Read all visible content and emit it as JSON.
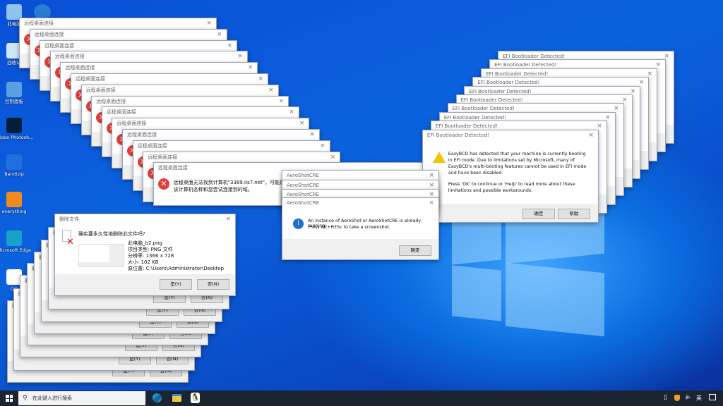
{
  "desktop": {
    "icons": [
      {
        "label": "此电脑",
        "icon": "computer-icon",
        "color": "#8ec5f0"
      },
      {
        "label": "回收站",
        "icon": "recycle-bin-icon",
        "color": "#cfe6f7"
      },
      {
        "label": "控制面板",
        "icon": "control-panel-icon",
        "color": "#5aa0e0"
      },
      {
        "label": "Adobe Photosh...",
        "icon": "photoshop-icon",
        "color": "#001e36"
      },
      {
        "label": "Bandizip",
        "icon": "bandizip-icon",
        "color": "#1f6fe0"
      },
      {
        "label": "everything",
        "icon": "everything-icon",
        "color": "#f08a1c"
      },
      {
        "label": "Microsoft Edge",
        "icon": "edge-icon",
        "color": "#1aa1c8"
      },
      {
        "label": "QQ",
        "icon": "qq-icon",
        "color": "#ffffff"
      }
    ]
  },
  "remote": {
    "title": "远程桌面连接",
    "message_line1": "远程桌面无法找到计算机\"3389.iis7.net\"。可能是\"338",
    "message_line2": "该计算机名称和您尝试连接到的域。"
  },
  "efi": {
    "title": "EFI Bootloader Detected!",
    "close": "×",
    "message1": "EasyBCD has detected that your machine is currently booting in EFI mode. Due to limitations set by Microsoft, many of EasyBCD's multi-booting features cannot be used in EFI mode and have been disabled.",
    "message2": "Press 'OK' to continue or 'Help' to read more about these limitations and possible workarounds.",
    "ok": "确定",
    "help": "帮助"
  },
  "aero": {
    "title": "AeroShotCRE",
    "message1": "An instance of AeroShot or AeroShotCRE is already running.",
    "message2": "Press Alt+PrtSc to take a screenshot.",
    "ok": "确定"
  },
  "delete": {
    "title": "删除文件",
    "question": "确实要永久性地删除此文件吗?",
    "filename": "此电脑_b2.png",
    "type": "项目类型: PNG 文件",
    "resolution": "分辨率: 1366 x 728",
    "size": "大小: 102 KB",
    "location": "原位置: C:\\Users\\Administrator\\Desktop",
    "yes": "是(Y)",
    "no": "否(N)"
  },
  "taskbar": {
    "search_placeholder": "在此键入进行搜索",
    "ime": "英",
    "apps": [
      "edge-icon",
      "file-explorer-icon",
      "qq-icon"
    ]
  }
}
